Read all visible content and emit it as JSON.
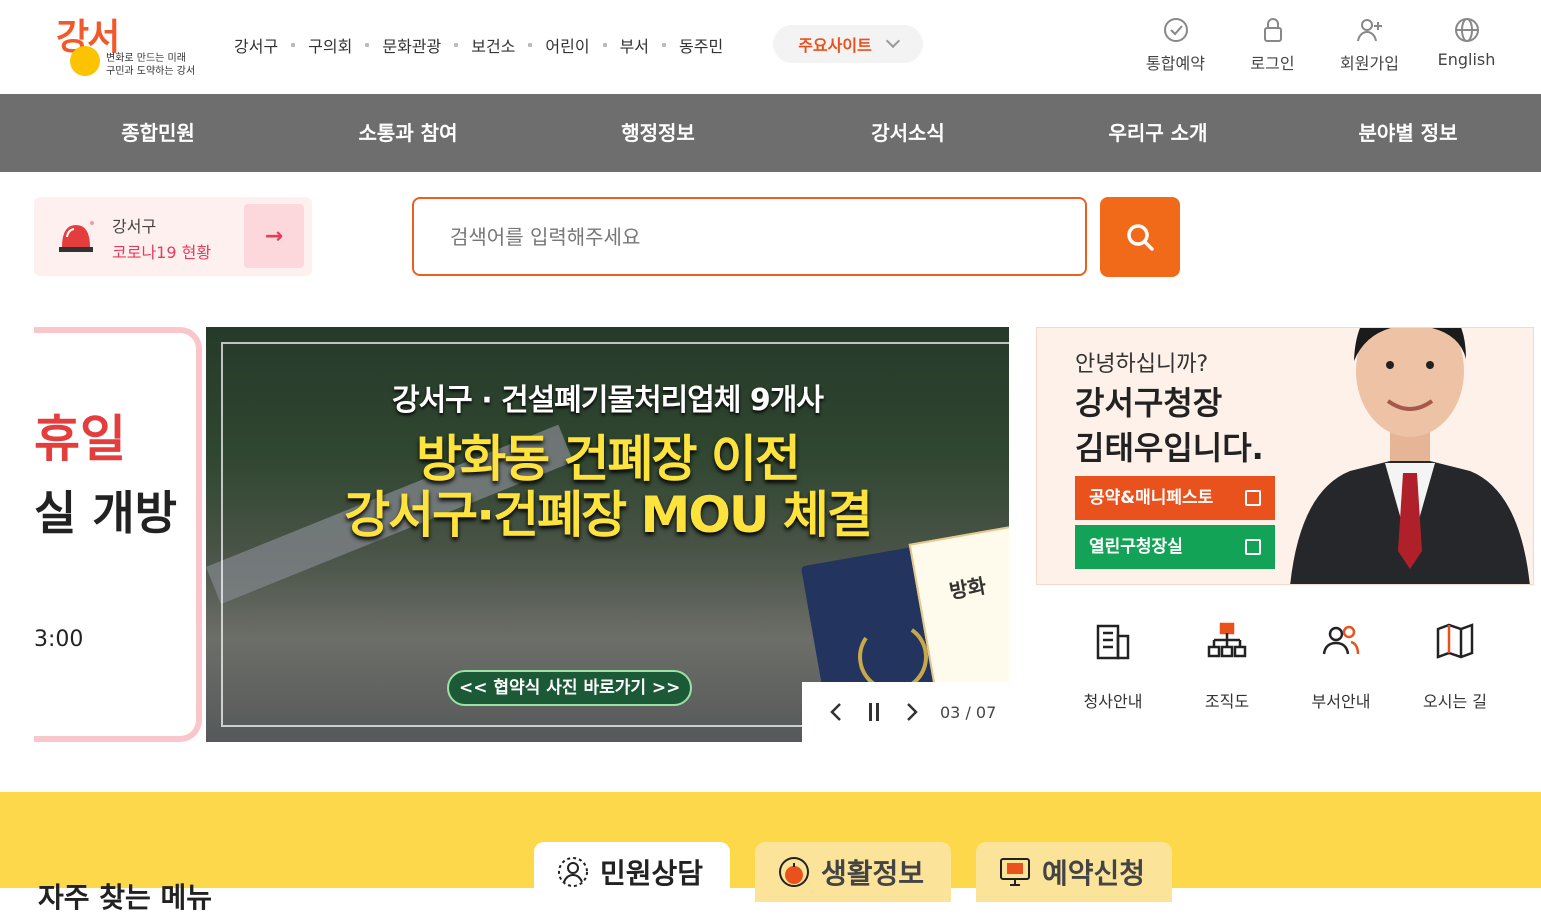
{
  "header": {
    "logo_text": "강서",
    "logo_tagline_1": "변화로 만드는 미래",
    "logo_tagline_2": "구민과 도약하는 강서",
    "links": [
      "강서구",
      "구의회",
      "문화관광",
      "보건소",
      "어린이",
      "부서",
      "동주민"
    ],
    "main_sites_label": "주요사이트",
    "utils": [
      {
        "label": "통합예약",
        "icon": "check-circle-icon"
      },
      {
        "label": "로그인",
        "icon": "lock-icon"
      },
      {
        "label": "회원가입",
        "icon": "add-user-icon"
      },
      {
        "label": "English",
        "icon": "globe-icon"
      }
    ]
  },
  "nav": {
    "menus": [
      "종합민원",
      "소통과 참여",
      "행정정보",
      "강서소식",
      "우리구 소개",
      "분야별 정보"
    ]
  },
  "corona": {
    "line1": "강서구",
    "line2": "코로나19 현황",
    "arrow": "→"
  },
  "search": {
    "placeholder": "검색어를 입력해주세요"
  },
  "prev_slide": {
    "line1": "휴일",
    "line2": "실 개방",
    "line3": "3:00"
  },
  "banner": {
    "line1": "강서구 · 건설폐기물처리업체 9개사",
    "line2": "방화동 건폐장 이전",
    "line3": "강서구·건폐장 MOU 체결",
    "photo_link": "<< 협약식 사진 바로가기 >>",
    "paper_text": "방화",
    "page": "03 / 07"
  },
  "mayor": {
    "greeting": "안녕하십니까?",
    "name1": "강서구청장",
    "name2": "김태우입니다.",
    "btn_pledge": "공약&매니페스토",
    "btn_open": "열린구청장실"
  },
  "quick": [
    {
      "label": "청사안내",
      "icon": "building-icon"
    },
    {
      "label": "조직도",
      "icon": "org-chart-icon"
    },
    {
      "label": "부서안내",
      "icon": "people-icon"
    },
    {
      "label": "오시는 길",
      "icon": "map-icon"
    }
  ],
  "bottom": {
    "frequent": "자주 찾는 메뉴",
    "tabs": [
      "민원상담",
      "생활정보",
      "예약신청"
    ]
  },
  "colors": {
    "accent": "#f06a1a",
    "nav_bg": "#6e6e6e",
    "green": "#13a357",
    "yellow": "#fed84b"
  }
}
